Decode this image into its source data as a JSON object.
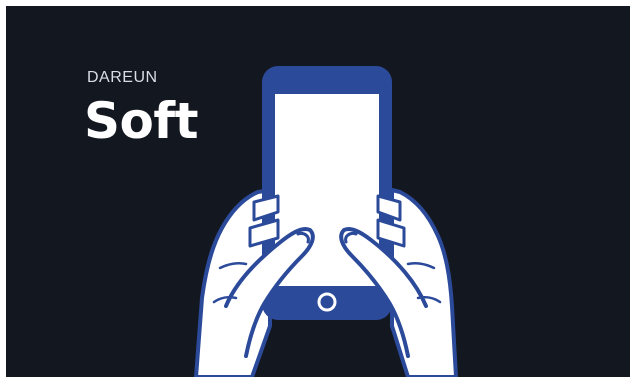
{
  "brand": {
    "prefix": "DAREUN",
    "name": "Soft"
  },
  "colors": {
    "background": "#131720",
    "phone_body": "#2c4a9a",
    "screen": "#ffffff",
    "hand_fill": "#ffffff",
    "hand_outline": "#2c4a9a",
    "text_primary": "#ffffff",
    "text_secondary": "#d9dde4"
  },
  "icons": [
    "smartphone-icon",
    "home-button-icon",
    "left-hand-icon",
    "right-hand-icon"
  ]
}
